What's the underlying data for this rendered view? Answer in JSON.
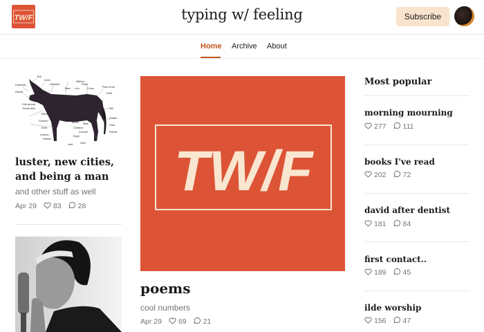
{
  "header": {
    "logo_text": "TW/F",
    "site_title": "typing w/ feeling",
    "subscribe_label": "Subscribe"
  },
  "nav": {
    "tabs": [
      {
        "label": "Home",
        "active": true
      },
      {
        "label": "Archive",
        "active": false
      },
      {
        "label": "About",
        "active": false
      }
    ]
  },
  "left_post": {
    "title": "luster, new cities, and being a man",
    "subtitle": "and other stuff as well",
    "date": "Apr 29",
    "likes": "83",
    "comments": "28",
    "image_labels": [
      "Poll",
      "Crest",
      "Shoulder",
      "Withers",
      "Back",
      "Loin",
      "Flank",
      "Croup",
      "Point of hip",
      "Forehead",
      "Muzzle",
      "Dock",
      "Chin groove",
      "Throat latch",
      "Elbow",
      "Tail",
      "Forearm",
      "Barrel",
      "Stifle",
      "Gaskin",
      "Knee",
      "Chestnut",
      "Hock",
      "Cannon",
      "Ergot",
      "Coronet",
      "Pastern",
      "Heel",
      "Hoof",
      "Fetlock"
    ]
  },
  "feature_post": {
    "image_text": "TW/F",
    "title": "poems",
    "subtitle": "cool numbers",
    "date": "Apr 29",
    "likes": "69",
    "comments": "21"
  },
  "popular": {
    "heading": "Most popular",
    "items": [
      {
        "title": "morning mourning",
        "likes": "277",
        "comments": "111"
      },
      {
        "title": "books I've read",
        "likes": "202",
        "comments": "72"
      },
      {
        "title": "david after dentist",
        "likes": "181",
        "comments": "84"
      },
      {
        "title": "first contact..",
        "likes": "189",
        "comments": "45"
      },
      {
        "title": "ilde worship",
        "likes": "156",
        "comments": "47"
      }
    ]
  },
  "colors": {
    "brand": "#dd5336",
    "accent": "#c0551f",
    "subscribe_bg": "#f8e3cc",
    "cream": "#f9e6d0"
  },
  "icons": {
    "like": "heart-icon",
    "comment": "comment-bubble-icon"
  }
}
